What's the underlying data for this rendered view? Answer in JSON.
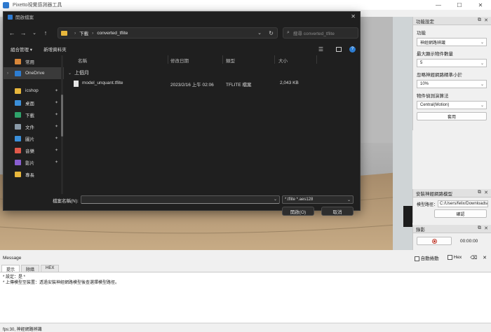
{
  "window": {
    "title": "Pixetto視覺感測器工具",
    "controls": [
      "—",
      "☐",
      "✕"
    ]
  },
  "right_panel": {
    "function_settings": {
      "title": "功能設定",
      "function_label": "功能",
      "function_value": "神經網路辨識",
      "max_objects_label": "最大顯示物件數量",
      "max_objects_value": "5",
      "ignore_label": "忽略神經網路精準小於",
      "ignore_value": "10%",
      "algo_label": "物件偵測演算法",
      "algo_value": "Central(Motion)",
      "apply_label": "套用"
    },
    "model": {
      "title": "安裝神經網路模型",
      "path_label": "模型路徑：",
      "path_value": "C:/Users/felix/Downloads/cor",
      "confirm_label": "確認"
    },
    "record": {
      "title": "錄影",
      "time": "00:00:00"
    }
  },
  "message": {
    "label": "Message",
    "auto_scroll_label": "自動捲動",
    "hex_label": "Hex",
    "tabs": [
      "提示",
      "除錯",
      "HEX"
    ],
    "lines": [
      "* 設定：是 *",
      "* 上傳模型至裝置：透過安裝神經網路模型後查選擇模型路徑。"
    ]
  },
  "status_bar": "fps:30, 神經網路辨識",
  "dialog": {
    "title": "開啟檔案",
    "breadcrumb": [
      "下載",
      "converted_tflite"
    ],
    "search_placeholder": "搜尋 converted_tflite",
    "organize_label": "組合管理 ▾",
    "new_folder_label": "新增資料夾",
    "nav_items": [
      {
        "label": "常用",
        "icon": "home-icon",
        "color": "#d8873a",
        "pinned": false
      },
      {
        "label": "OneDrive",
        "icon": "cloud-icon",
        "color": "#2d7dd2",
        "pinned": false,
        "selected": true
      },
      {
        "label": "icshop",
        "icon": "folder-icon",
        "color": "#e8b73c",
        "pinned": true
      },
      {
        "label": "桌面",
        "icon": "desktop-icon",
        "color": "#3b8fd9",
        "pinned": true
      },
      {
        "label": "下載",
        "icon": "download-icon",
        "color": "#2fa36b",
        "pinned": true
      },
      {
        "label": "文件",
        "icon": "document-icon",
        "color": "#8a9aa8",
        "pinned": true
      },
      {
        "label": "圖片",
        "icon": "picture-icon",
        "color": "#3b8fd9",
        "pinned": true
      },
      {
        "label": "音樂",
        "icon": "music-icon",
        "color": "#e0594b",
        "pinned": true
      },
      {
        "label": "影片",
        "icon": "video-icon",
        "color": "#8a5fd1",
        "pinned": true
      },
      {
        "label": "專長",
        "icon": "folder-icon",
        "color": "#e8b73c",
        "pinned": false
      }
    ],
    "columns": [
      "名稱",
      "修改日期",
      "類型",
      "大小"
    ],
    "group_label": "上個月",
    "files": [
      {
        "name": "model_unquant.tflite",
        "date": "2023/2/16 上午 02:06",
        "type": "TFLITE 檔案",
        "size": "2,043 KB"
      }
    ],
    "filename_label": "檔案名稱(N):",
    "filetype_value": "*.tflite *.aes128",
    "open_label": "開啟(O)",
    "cancel_label": "取消"
  }
}
